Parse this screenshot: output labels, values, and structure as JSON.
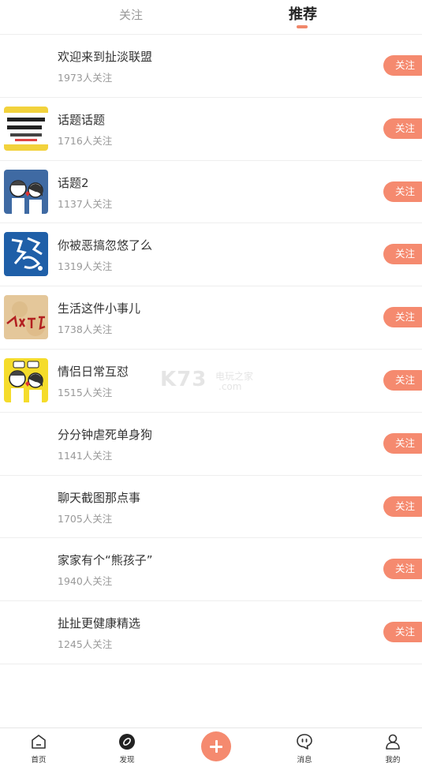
{
  "header": {
    "tabs": [
      {
        "label": "关注",
        "active": false
      },
      {
        "label": "推荐",
        "active": true
      }
    ],
    "accent_color": "#f58a6f"
  },
  "topics": [
    {
      "title": "欢迎来到扯淡联盟",
      "followers": "1973人关注",
      "button": "关注",
      "thumb": "none"
    },
    {
      "title": "话题话题",
      "followers": "1716人关注",
      "button": "关注",
      "thumb": "comic-text-image"
    },
    {
      "title": "话题2",
      "followers": "1137人关注",
      "button": "关注",
      "thumb": "cartoon-couple-blue"
    },
    {
      "title": "你被恶搞忽悠了么",
      "followers": "1319人关注",
      "button": "关注",
      "thumb": "blue-calligraphy-image"
    },
    {
      "title": "生活这件小事儿",
      "followers": "1738人关注",
      "button": "关注",
      "thumb": "beige-calligraphy-image"
    },
    {
      "title": "情侣日常互怼",
      "followers": "1515人关注",
      "button": "关注",
      "thumb": "cartoon-couple-yellow"
    },
    {
      "title": "分分钟虐死单身狗",
      "followers": "1141人关注",
      "button": "关注",
      "thumb": "none"
    },
    {
      "title": "聊天截图那点事",
      "followers": "1705人关注",
      "button": "关注",
      "thumb": "none"
    },
    {
      "title": "家家有个“熊孩子”",
      "followers": "1940人关注",
      "button": "关注",
      "thumb": "none"
    },
    {
      "title": "扯扯更健康精选",
      "followers": "1245人关注",
      "button": "关注",
      "thumb": "none"
    }
  ],
  "watermark": {
    "brand": "K73",
    "cn": "电玩之家",
    "domain": ".com"
  },
  "bottom_nav": {
    "home": "首页",
    "discover": "发现",
    "add": "add-icon",
    "messages": "消息",
    "me": "我的"
  }
}
